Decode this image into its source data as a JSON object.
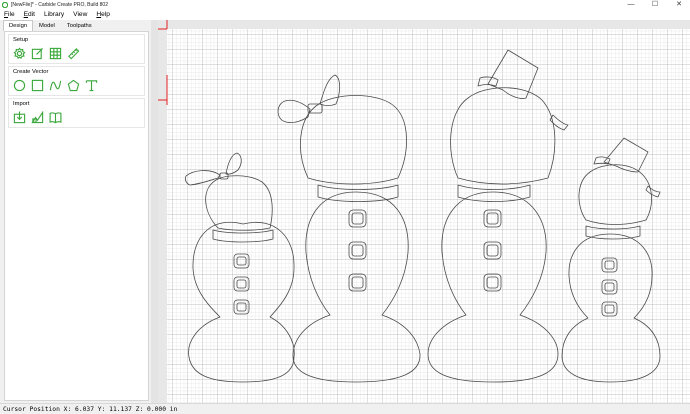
{
  "window": {
    "title": "[NewFile]* - Carbide Create PRO, Build 802",
    "controls": [
      "—",
      "☐",
      "✕"
    ]
  },
  "menubar": {
    "items": [
      {
        "key": "F",
        "rest": "ile"
      },
      {
        "key": "E",
        "rest": "dit"
      },
      {
        "key": "",
        "rest": "Library"
      },
      {
        "key": "",
        "rest": "View"
      },
      {
        "key": "H",
        "rest": "elp"
      }
    ]
  },
  "tabs": [
    {
      "label": "Design",
      "active": true
    },
    {
      "label": "Model",
      "active": false
    },
    {
      "label": "Toolpaths",
      "active": false
    }
  ],
  "sections": {
    "setup": {
      "title": "Setup",
      "icons": [
        "gear-icon",
        "edit-icon",
        "grid-icon",
        "measure-icon"
      ]
    },
    "create_vector": {
      "title": "Create Vector",
      "icons": [
        "circle-icon",
        "rectangle-icon",
        "curve-icon",
        "polygon-icon",
        "text-icon"
      ]
    },
    "import": {
      "title": "Import",
      "icons": [
        "import-icon",
        "image-trace-icon",
        "book-icon"
      ]
    }
  },
  "accent_color": "#3aa83a",
  "origin_marker_color": "#e02020",
  "status": {
    "cursor_position": "Cursor Position X: 6.037 Y: 11.137 Z: 0.000 in"
  }
}
